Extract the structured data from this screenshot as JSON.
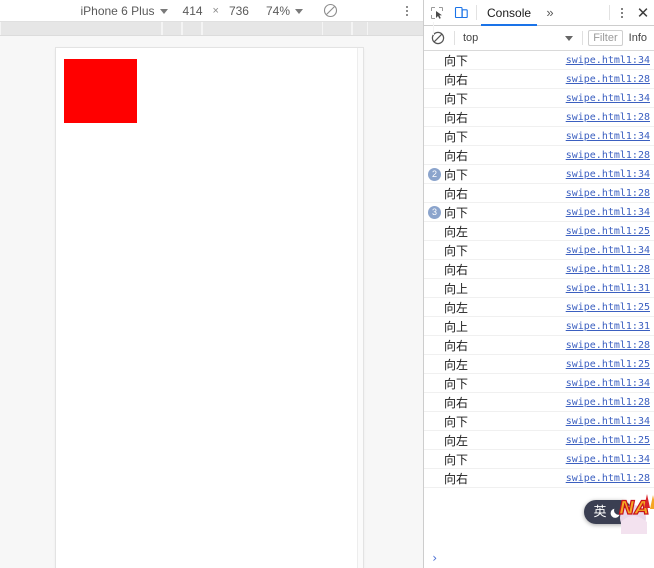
{
  "device_toolbar": {
    "device_name": "iPhone 6 Plus",
    "width": "414",
    "height": "736",
    "times_symbol": "×",
    "zoom": "74%",
    "rotate_icon": "rotate-icon",
    "kebab_icon": "more-options-icon",
    "device_caret_icon": "chevron-down-icon",
    "zoom_caret_icon": "chevron-down-icon"
  },
  "viewport": {
    "red_box_color": "#ff0000",
    "background_color": "#ffffff",
    "scrollbar": "vertical-scrollbar"
  },
  "devtools": {
    "inspect_icon": "inspect-element-icon",
    "device_toggle_icon": "toggle-device-toolbar-icon",
    "tabs": [
      {
        "label": "Console",
        "active": true
      }
    ],
    "more_tabs_label": "»",
    "kebab_icon": "devtools-more-options-icon",
    "close_label": "✕",
    "filterbar": {
      "clear_icon": "clear-console-icon",
      "context": "top",
      "context_caret_icon": "chevron-down-icon",
      "filter_placeholder": "Filter",
      "level": "Info"
    },
    "prompt_caret": "›",
    "log_entries": [
      {
        "badge": "",
        "message": "向下",
        "source": "swipe.html1:34"
      },
      {
        "badge": "",
        "message": "向右",
        "source": "swipe.html1:28"
      },
      {
        "badge": "",
        "message": "向下",
        "source": "swipe.html1:34"
      },
      {
        "badge": "",
        "message": "向右",
        "source": "swipe.html1:28"
      },
      {
        "badge": "",
        "message": "向下",
        "source": "swipe.html1:34"
      },
      {
        "badge": "",
        "message": "向右",
        "source": "swipe.html1:28"
      },
      {
        "badge": "2",
        "message": "向下",
        "source": "swipe.html1:34"
      },
      {
        "badge": "",
        "message": "向右",
        "source": "swipe.html1:28"
      },
      {
        "badge": "3",
        "message": "向下",
        "source": "swipe.html1:34"
      },
      {
        "badge": "",
        "message": "向左",
        "source": "swipe.html1:25"
      },
      {
        "badge": "",
        "message": "向下",
        "source": "swipe.html1:34"
      },
      {
        "badge": "",
        "message": "向右",
        "source": "swipe.html1:28"
      },
      {
        "badge": "",
        "message": "向上",
        "source": "swipe.html1:31"
      },
      {
        "badge": "",
        "message": "向左",
        "source": "swipe.html1:25"
      },
      {
        "badge": "",
        "message": "向上",
        "source": "swipe.html1:31"
      },
      {
        "badge": "",
        "message": "向右",
        "source": "swipe.html1:28"
      },
      {
        "badge": "",
        "message": "向左",
        "source": "swipe.html1:25"
      },
      {
        "badge": "",
        "message": "向下",
        "source": "swipe.html1:34"
      },
      {
        "badge": "",
        "message": "向右",
        "source": "swipe.html1:28"
      },
      {
        "badge": "",
        "message": "向下",
        "source": "swipe.html1:34"
      },
      {
        "badge": "",
        "message": "向左",
        "source": "swipe.html1:25"
      },
      {
        "badge": "",
        "message": "向下",
        "source": "swipe.html1:34"
      },
      {
        "badge": "",
        "message": "向右",
        "source": "swipe.html1:28"
      }
    ]
  },
  "overlays": {
    "ime": {
      "mode_char": "英",
      "moon_icon": "moon-icon",
      "background_color": "#3b3f52"
    },
    "floating_badge": {
      "text": "NA",
      "name": "naruto-floating-graphic"
    }
  }
}
